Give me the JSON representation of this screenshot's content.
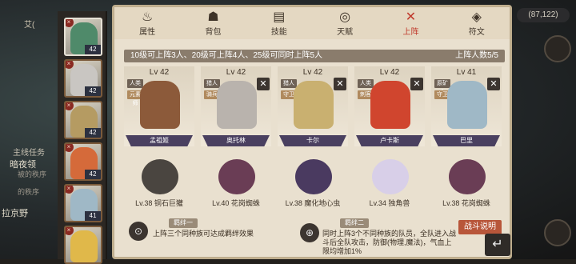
{
  "world": {
    "top_label": "艾(",
    "main_quest_label": "主线任务",
    "quest_line": "暗夜领",
    "quest_sub": "的秩序",
    "quest_sub2": "被的秩序",
    "region": "拉京野"
  },
  "currency": {
    "value": "87,122"
  },
  "tabs": [
    {
      "label": "属性",
      "icon": "flame-icon",
      "glyph": "♨"
    },
    {
      "label": "背包",
      "icon": "bag-icon",
      "glyph": "☗"
    },
    {
      "label": "技能",
      "icon": "book-icon",
      "glyph": "▤"
    },
    {
      "label": "天赋",
      "icon": "eye-icon",
      "glyph": "◎"
    },
    {
      "label": "上阵",
      "icon": "crossed-swords-icon",
      "glyph": "✕"
    },
    {
      "label": "符文",
      "icon": "rune-icon",
      "glyph": "◈"
    }
  ],
  "header": {
    "rule": "10级可上阵3人、20级可上阵4人、25级可同时上阵5人",
    "count": "上阵人数5/5"
  },
  "hero_column": [
    {
      "level": "42",
      "color": "#4f8a6a"
    },
    {
      "level": "42",
      "color": "#c9c6c2"
    },
    {
      "level": "42",
      "color": "#b59b62"
    },
    {
      "level": "42",
      "color": "#d56a3a"
    },
    {
      "level": "41",
      "color": "#9fb8c6"
    },
    {
      "level": "",
      "color": "#e0b84a"
    }
  ],
  "heroes": [
    {
      "lv": "Lv 42",
      "tags": [
        "人类",
        "元素师"
      ],
      "name": "孟祖姬",
      "color": "#8c5a3a",
      "removable": false
    },
    {
      "lv": "Lv 42",
      "tags": [
        "猎人",
        "骑兵"
      ],
      "name": "奥托林",
      "color": "#b9b3ad",
      "removable": true
    },
    {
      "lv": "Lv 42",
      "tags": [
        "猎人",
        "守卫"
      ],
      "name": "卡尔",
      "color": "#c9b070",
      "removable": true
    },
    {
      "lv": "Lv 42",
      "tags": [
        "人类",
        "刺客"
      ],
      "name": "卢卡斯",
      "color": "#d0452e",
      "removable": true
    },
    {
      "lv": "Lv 41",
      "tags": [
        "原矿人",
        "守卫"
      ],
      "name": "巴里",
      "color": "#9fb8c6",
      "removable": true
    }
  ],
  "pets": [
    {
      "label": "Lv.38 铜石巨獾",
      "color": "#4a4540"
    },
    {
      "label": "Lv.40 花岗蜘蛛",
      "color": "#6a3d55"
    },
    {
      "label": "Lv.38 魔化地心虫",
      "color": "#4a3a60"
    },
    {
      "label": "Lv.34 独角兽",
      "color": "#d8cfe8"
    },
    {
      "label": "Lv.38 花岗蜘蛛",
      "color": "#6a3d55"
    }
  ],
  "bonds": [
    {
      "title": "羁绊一",
      "text": "上阵三个同种族可达成羁绊效果",
      "glyph": "⊙"
    },
    {
      "title": "羁绊二",
      "text": "同时上阵3个不同种族的队员，全队进入战斗后全队攻击，防御(物理,魔法)，气血上限均增加1%",
      "glyph": "⊕"
    }
  ],
  "battle_button": "战斗说明",
  "back_glyph": "↵"
}
